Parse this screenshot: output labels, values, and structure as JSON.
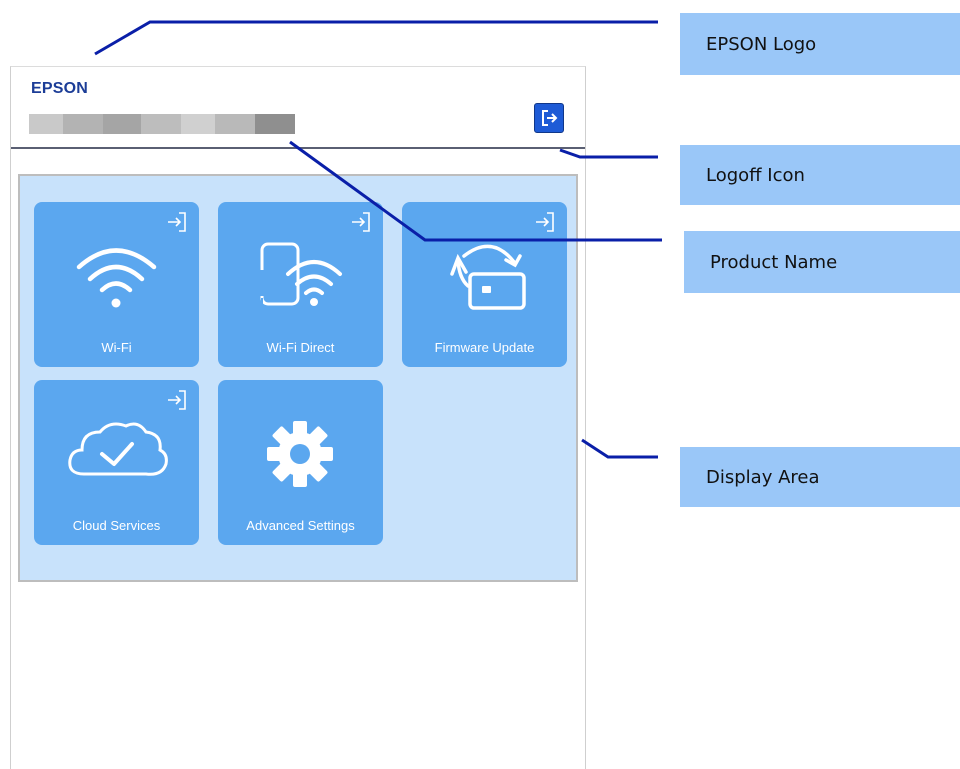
{
  "logo": {
    "text": "EPSON"
  },
  "header": {
    "logoff_icon": "logoff-icon"
  },
  "tiles": [
    {
      "label": "Wi-Fi",
      "icon": "wifi-icon"
    },
    {
      "label": "Wi-Fi Direct",
      "icon": "wifi-direct-icon"
    },
    {
      "label": "Firmware Update",
      "icon": "firmware-update-icon"
    },
    {
      "label": "Cloud Services",
      "icon": "cloud-check-icon"
    },
    {
      "label": "Advanced Settings",
      "icon": "gear-icon"
    }
  ],
  "callouts": {
    "epson_logo": "EPSON Logo",
    "logoff_icon": "Logoff Icon",
    "product_name": "Product Name",
    "display_area": "Display Area"
  },
  "colors": {
    "tile": "#5ba7ef",
    "display_area": "#c8e2fb",
    "callout": "#9ac7f8",
    "leader_line": "#0a1fa8",
    "logo": "#1c3d97"
  }
}
